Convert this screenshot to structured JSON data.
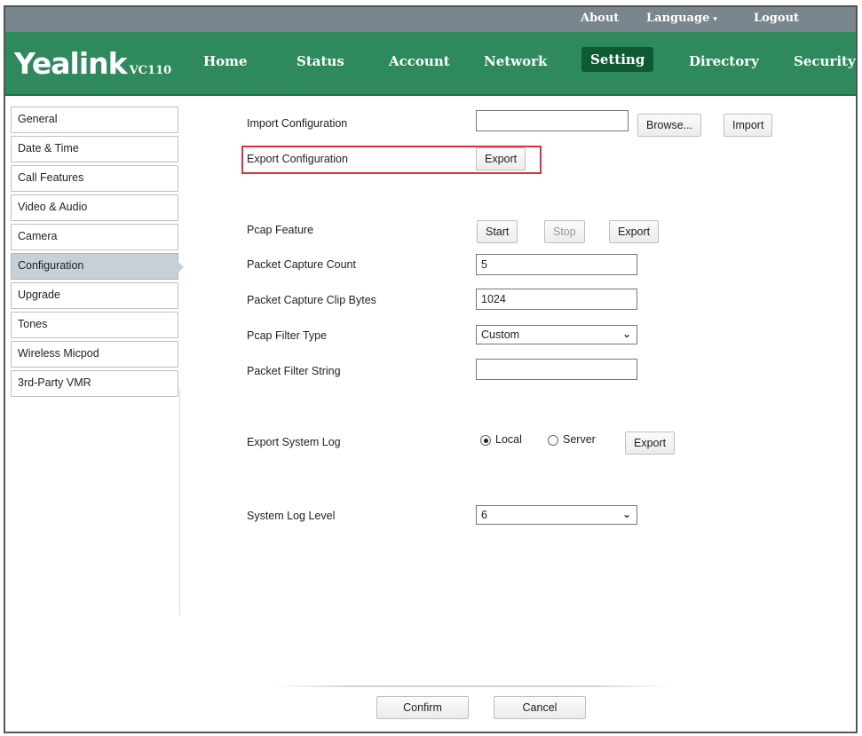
{
  "topbar": {
    "about": "About",
    "language": "Language",
    "language_caret": "▾",
    "logout": "Logout"
  },
  "brand": {
    "logo": "Yealink",
    "model": "VC110"
  },
  "nav": {
    "home": "Home",
    "status": "Status",
    "account": "Account",
    "network": "Network",
    "setting": "Setting",
    "directory": "Directory",
    "security": "Security"
  },
  "sidebar": {
    "items": [
      {
        "label": "General"
      },
      {
        "label": "Date & Time"
      },
      {
        "label": "Call Features"
      },
      {
        "label": "Video & Audio"
      },
      {
        "label": "Camera"
      },
      {
        "label": "Configuration"
      },
      {
        "label": "Upgrade"
      },
      {
        "label": "Tones"
      },
      {
        "label": "Wireless Micpod"
      },
      {
        "label": "3rd-Party VMR"
      }
    ]
  },
  "form": {
    "import_config": {
      "label": "Import Configuration",
      "value": "",
      "browse": "Browse...",
      "import": "Import"
    },
    "export_config": {
      "label": "Export Configuration",
      "export": "Export"
    },
    "pcap": {
      "label": "Pcap Feature",
      "start": "Start",
      "stop": "Stop",
      "export": "Export"
    },
    "packet_count": {
      "label": "Packet Capture Count",
      "value": "5"
    },
    "clip_bytes": {
      "label": "Packet Capture Clip Bytes",
      "value": "1024"
    },
    "filter_type": {
      "label": "Pcap Filter Type",
      "value": "Custom"
    },
    "filter_string": {
      "label": "Packet Filter String",
      "value": ""
    },
    "system_log": {
      "label": "Export System Log",
      "local": "Local",
      "server": "Server",
      "export": "Export"
    },
    "log_level": {
      "label": "System Log Level",
      "value": "6"
    }
  },
  "footer": {
    "confirm": "Confirm",
    "cancel": "Cancel"
  },
  "colors": {
    "nav_green": "#2e8a5c",
    "active_tab": "#0f5a35",
    "highlight_red": "#d9323a",
    "topbar_gray": "#79868d"
  }
}
